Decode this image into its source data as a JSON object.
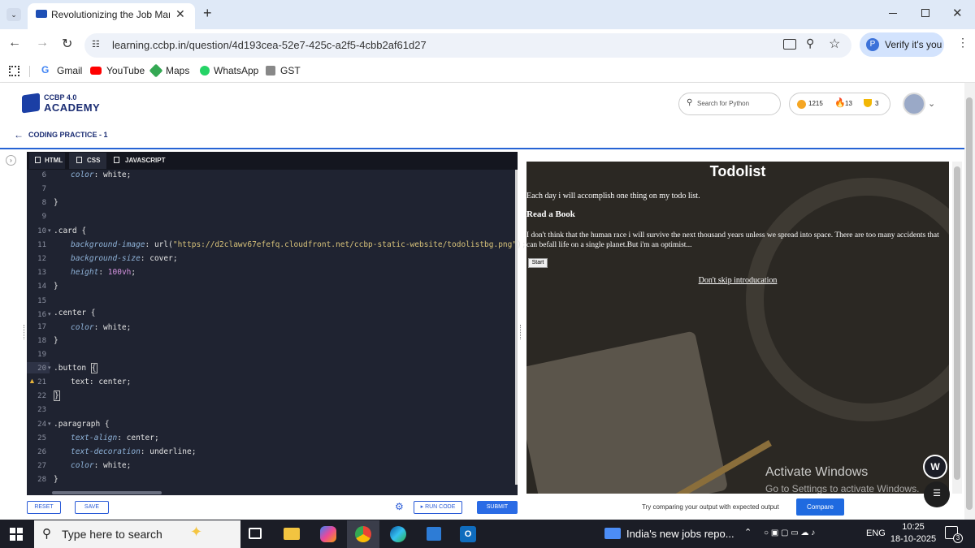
{
  "browser": {
    "tab_title": "Revolutionizing the Job Market",
    "url": "learning.ccbp.in/question/4d193cea-52e7-425c-a2f5-4cbb2af61d27",
    "verify_label": "Verify it's you",
    "profile_letter": "P",
    "bookmarks": [
      "Gmail",
      "YouTube",
      "Maps",
      "WhatsApp",
      "GST"
    ]
  },
  "app": {
    "logo_line1": "CCBP 4.0",
    "logo_line2": "ACADEMY",
    "search_placeholder": "Search for Python",
    "coins": "1215",
    "streak": "13",
    "trophies": "3",
    "back_label": "CODING PRACTICE - 1"
  },
  "editor": {
    "tabs": [
      "HTML",
      "CSS",
      "JAVASCRIPT"
    ],
    "line_numbers": [
      "6",
      "7",
      "8",
      "9",
      "10",
      "11",
      "12",
      "13",
      "14",
      "15",
      "16",
      "17",
      "18",
      "19",
      "20",
      "21",
      "22",
      "23",
      "24",
      "25",
      "26",
      "27",
      "28"
    ]
  },
  "preview": {
    "heading": "Todolist",
    "intro": "Each day i will accomplish one thing on my todo list.",
    "subheading": "Read a Book",
    "quote": "I don't think that the human race i will survive the next thousand years unless we spread into space. There are too many accidents that can befall life on a single planet.But i'm an optimist...",
    "button": "Start",
    "link": "Don't skip introducation",
    "watermark_title": "Activate Windows",
    "watermark_sub": "Go to Settings to activate Windows."
  },
  "footer": {
    "reset": "RESET",
    "save": "SAVE",
    "run_code": "RUN CODE",
    "submit": "SUBMIT",
    "compare_hint": "Try comparing your output with expected output",
    "compare": "Compare"
  },
  "taskbar": {
    "search_placeholder": "Type here to search",
    "news": "India's new jobs repo...",
    "lang": "ENG",
    "time": "10:25",
    "date": "18-10-2025",
    "notif_count": "3"
  },
  "colors": {
    "accent": "#2563d4",
    "editor_bg": "#1f2331",
    "taskbar": "#1b1d26"
  }
}
